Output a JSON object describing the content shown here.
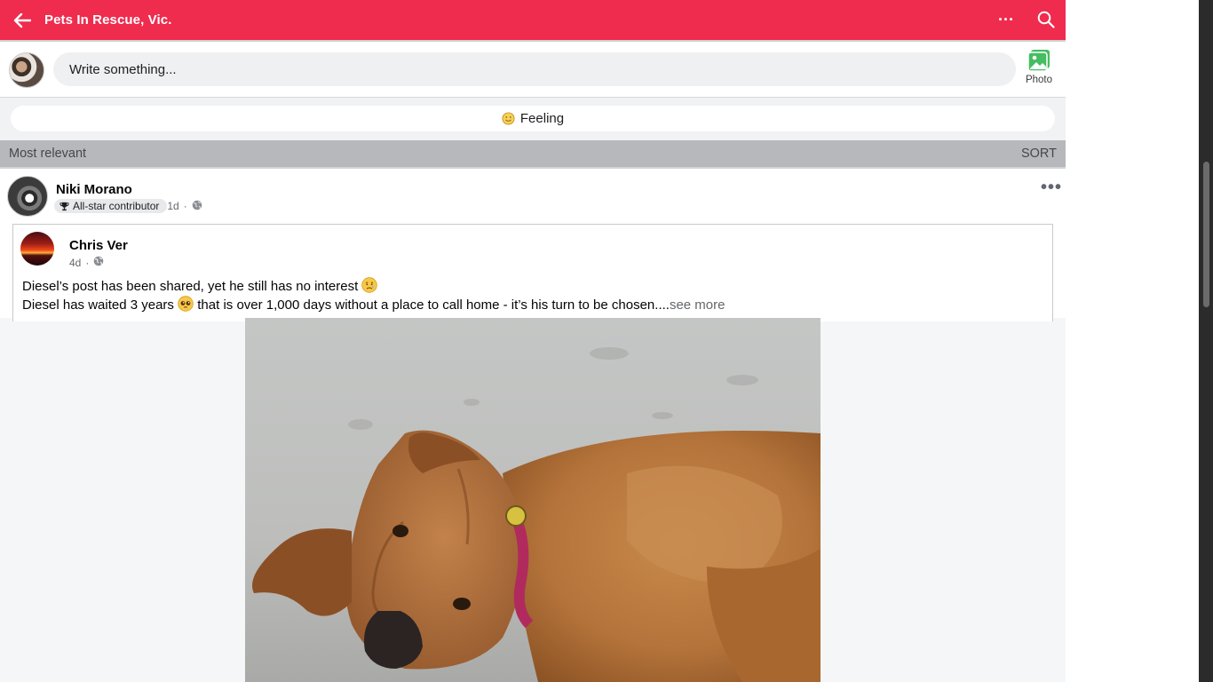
{
  "topbar": {
    "title": "Pets In Rescue, Vic.",
    "background": "#ef2b4e",
    "back_icon": "arrow-left-icon",
    "more_label": "···",
    "search_icon": "search-icon"
  },
  "composer": {
    "placeholder": "Write something...",
    "photo_label": "Photo",
    "photo_icon": "photo-icon"
  },
  "feeling": {
    "label": "Feeling",
    "icon": "smile-icon"
  },
  "sort": {
    "label": "Most relevant",
    "action": "SORT"
  },
  "post": {
    "author": "Niki Morano",
    "badge": "All-star contributor",
    "time": "1d",
    "separator": "·",
    "more_label": "•••",
    "shared": {
      "author": "Chris Ver",
      "time": "4d",
      "separator": "·",
      "line1": "Diesel’s post has been shared, yet he still has no interest",
      "line1_emoji": "😢",
      "line2_prefix": "Diesel has waited 3 years",
      "line2_emoji": "🥺",
      "line2_text": "that is over 1,000 days without a place to call home - it’s his turn to be chosen....",
      "see_more": "see more"
    }
  }
}
